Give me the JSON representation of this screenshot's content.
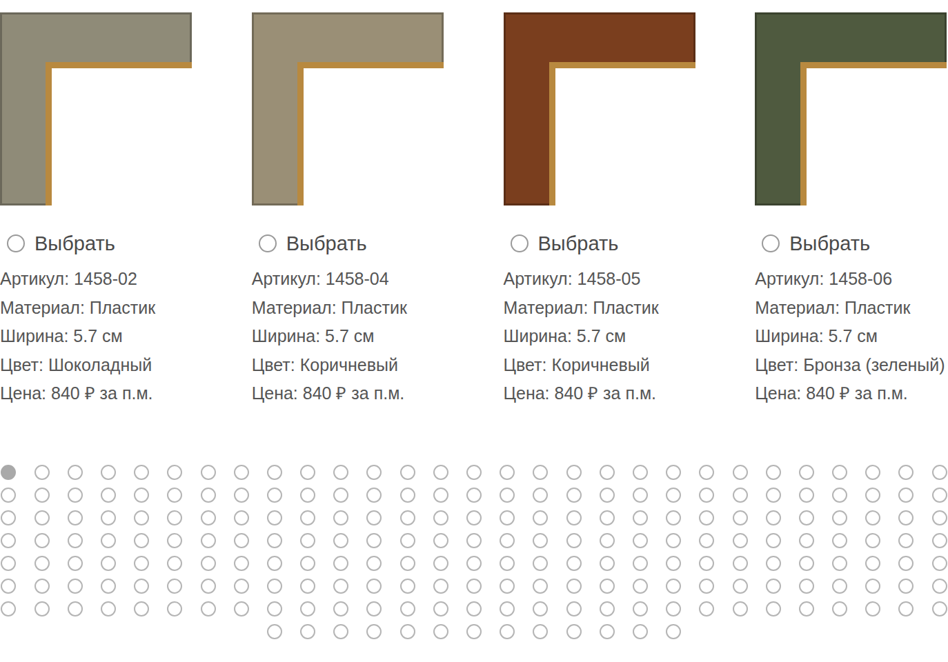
{
  "cards": [
    {
      "color": "#8f8b78",
      "select": {
        "label": "Выбрать",
        "selected": false
      },
      "specs": [
        "Артикул: 1458-02",
        "Материал: Пластик",
        "Ширина: 5.7 см",
        "Цвет: Шоколадный",
        "Цена: 840 ₽ за п.м."
      ]
    },
    {
      "color": "#9a8f76",
      "select": {
        "label": "Выбрать",
        "selected": false
      },
      "specs": [
        "Артикул: 1458-04",
        "Материал: Пластик",
        "Ширина: 5.7 см",
        "Цвет: Коричневый",
        "Цена: 840 ₽ за п.м."
      ]
    },
    {
      "color": "#7a3e1e",
      "select": {
        "label": "Выбрать",
        "selected": false
      },
      "specs": [
        "Артикул: 1458-05",
        "Материал: Пластик",
        "Ширина: 5.7 см",
        "Цвет: Коричневый",
        "Цена: 840 ₽ за п.м."
      ]
    },
    {
      "color": "#4f5a3f",
      "select": {
        "label": "Выбрать",
        "selected": false
      },
      "specs": [
        "Артикул: 1458-06",
        "Материал: Пластик",
        "Ширина: 5.7 см",
        "Цвет: Бронза (зеленый)",
        "Цена: 840 ₽ за п.м."
      ]
    }
  ],
  "pagination": [
    {
      "selected": true
    },
    {
      "selected": false
    },
    {
      "selected": false
    },
    {
      "selected": false
    },
    {
      "selected": false
    },
    {
      "selected": false
    },
    {
      "selected": false
    },
    {
      "selected": false
    },
    {
      "selected": false
    },
    {
      "selected": false
    },
    {
      "selected": false
    },
    {
      "selected": false
    },
    {
      "selected": false
    },
    {
      "selected": false
    },
    {
      "selected": false
    },
    {
      "selected": false
    },
    {
      "selected": false
    },
    {
      "selected": false
    },
    {
      "selected": false
    },
    {
      "selected": false
    },
    {
      "selected": false
    },
    {
      "selected": false
    },
    {
      "selected": false
    },
    {
      "selected": false
    },
    {
      "selected": false
    },
    {
      "selected": false
    },
    {
      "selected": false
    },
    {
      "selected": false
    },
    {
      "selected": false
    },
    {
      "selected": false
    },
    {
      "selected": false
    },
    {
      "selected": false
    },
    {
      "selected": false
    },
    {
      "selected": false
    },
    {
      "selected": false
    },
    {
      "selected": false
    },
    {
      "selected": false
    },
    {
      "selected": false
    },
    {
      "selected": false
    },
    {
      "selected": false
    },
    {
      "selected": false
    },
    {
      "selected": false
    },
    {
      "selected": false
    },
    {
      "selected": false
    },
    {
      "selected": false
    },
    {
      "selected": false
    },
    {
      "selected": false
    },
    {
      "selected": false
    },
    {
      "selected": false
    },
    {
      "selected": false
    },
    {
      "selected": false
    },
    {
      "selected": false
    },
    {
      "selected": false
    },
    {
      "selected": false
    },
    {
      "selected": false
    },
    {
      "selected": false
    },
    {
      "selected": false
    },
    {
      "selected": false
    },
    {
      "selected": false
    },
    {
      "selected": false
    },
    {
      "selected": false
    },
    {
      "selected": false
    },
    {
      "selected": false
    },
    {
      "selected": false
    },
    {
      "selected": false
    },
    {
      "selected": false
    },
    {
      "selected": false
    },
    {
      "selected": false
    },
    {
      "selected": false
    },
    {
      "selected": false
    },
    {
      "selected": false
    },
    {
      "selected": false
    },
    {
      "selected": false
    },
    {
      "selected": false
    },
    {
      "selected": false
    },
    {
      "selected": false
    },
    {
      "selected": false
    },
    {
      "selected": false
    },
    {
      "selected": false
    },
    {
      "selected": false
    },
    {
      "selected": false
    },
    {
      "selected": false
    },
    {
      "selected": false
    },
    {
      "selected": false
    },
    {
      "selected": false
    },
    {
      "selected": false
    },
    {
      "selected": false
    },
    {
      "selected": false
    },
    {
      "selected": false
    },
    {
      "selected": false
    },
    {
      "selected": false
    },
    {
      "selected": false
    },
    {
      "selected": false
    },
    {
      "selected": false
    },
    {
      "selected": false
    },
    {
      "selected": false
    },
    {
      "selected": false
    },
    {
      "selected": false
    },
    {
      "selected": false
    },
    {
      "selected": false
    },
    {
      "selected": false
    },
    {
      "selected": false
    },
    {
      "selected": false
    },
    {
      "selected": false
    },
    {
      "selected": false
    },
    {
      "selected": false
    },
    {
      "selected": false
    },
    {
      "selected": false
    },
    {
      "selected": false
    },
    {
      "selected": false
    },
    {
      "selected": false
    },
    {
      "selected": false
    },
    {
      "selected": false
    },
    {
      "selected": false
    },
    {
      "selected": false
    },
    {
      "selected": false
    },
    {
      "selected": false
    },
    {
      "selected": false
    },
    {
      "selected": false
    },
    {
      "selected": false
    },
    {
      "selected": false
    },
    {
      "selected": false
    },
    {
      "selected": false
    },
    {
      "selected": false
    },
    {
      "selected": false
    },
    {
      "selected": false
    },
    {
      "selected": false
    },
    {
      "selected": false
    },
    {
      "selected": false
    },
    {
      "selected": false
    },
    {
      "selected": false
    },
    {
      "selected": false
    },
    {
      "selected": false
    },
    {
      "selected": false
    },
    {
      "selected": false
    },
    {
      "selected": false
    },
    {
      "selected": false
    },
    {
      "selected": false
    },
    {
      "selected": false
    },
    {
      "selected": false
    },
    {
      "selected": false
    },
    {
      "selected": false
    },
    {
      "selected": false
    },
    {
      "selected": false
    },
    {
      "selected": false
    },
    {
      "selected": false
    },
    {
      "selected": false
    },
    {
      "selected": false
    },
    {
      "selected": false
    },
    {
      "selected": false
    },
    {
      "selected": false
    },
    {
      "selected": false
    },
    {
      "selected": false
    },
    {
      "selected": false
    },
    {
      "selected": false
    },
    {
      "selected": false
    },
    {
      "selected": false
    },
    {
      "selected": false
    },
    {
      "selected": false
    },
    {
      "selected": false
    },
    {
      "selected": false
    },
    {
      "selected": false
    },
    {
      "selected": false
    },
    {
      "selected": false
    },
    {
      "selected": false
    },
    {
      "selected": false
    },
    {
      "selected": false
    },
    {
      "selected": false
    },
    {
      "selected": false
    },
    {
      "selected": false
    },
    {
      "selected": false
    },
    {
      "selected": false
    },
    {
      "selected": false
    },
    {
      "selected": false
    },
    {
      "selected": false
    },
    {
      "selected": false
    },
    {
      "selected": false
    },
    {
      "selected": false
    },
    {
      "selected": false
    },
    {
      "selected": false
    },
    {
      "selected": false
    },
    {
      "selected": false
    },
    {
      "selected": false
    },
    {
      "selected": false
    },
    {
      "selected": false
    },
    {
      "selected": false
    },
    {
      "selected": false
    },
    {
      "selected": false
    },
    {
      "selected": false
    },
    {
      "selected": false
    },
    {
      "selected": false
    },
    {
      "selected": false
    },
    {
      "selected": false
    },
    {
      "selected": false
    },
    {
      "selected": false
    },
    {
      "selected": false
    },
    {
      "selected": false
    },
    {
      "selected": false
    },
    {
      "selected": false
    },
    {
      "selected": false
    },
    {
      "selected": false
    },
    {
      "selected": false
    },
    {
      "selected": false
    },
    {
      "selected": false
    },
    {
      "selected": false
    },
    {
      "selected": false
    },
    {
      "selected": false
    },
    {
      "selected": false
    },
    {
      "selected": false
    },
    {
      "selected": false
    },
    {
      "selected": false
    },
    {
      "selected": false
    },
    {
      "selected": false
    },
    {
      "selected": false
    },
    {
      "selected": false
    },
    {
      "selected": false
    }
  ]
}
